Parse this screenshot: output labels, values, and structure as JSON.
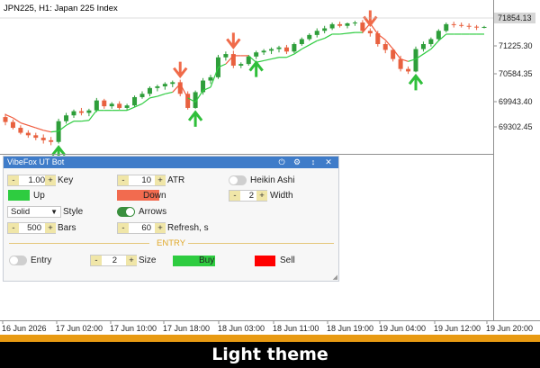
{
  "chart": {
    "title": "JPN225, H1:  Japan 225 Index",
    "current_price": "71854.13",
    "price_labels": [
      "71225.30",
      "70584.35",
      "69943.40",
      "69302.45"
    ],
    "time_labels": [
      "16 Jun 2026",
      "17 Jun 02:00",
      "17 Jun 10:00",
      "17 Jun 18:00",
      "18 Jun 03:00",
      "18 Jun 11:00",
      "18 Jun 19:00",
      "19 Jun 04:00",
      "19 Jun 12:00",
      "19 Jun 20:00"
    ],
    "colors": {
      "bull": "#2e9e3a",
      "bear": "#e8613f",
      "trail_up": "#2ecc40",
      "trail_down": "#f05a3c",
      "arrow_up": "#2fbf3a",
      "arrow_down": "#f06b4a",
      "price_tag": "#d6d6d6"
    }
  },
  "chart_data": {
    "type": "candlestick",
    "title": "JPN225, H1:  Japan 225 Index",
    "ylim": [
      68900,
      72200
    ],
    "candles_ohlc": [
      [
        69680,
        69760,
        69480,
        69560
      ],
      [
        69560,
        69620,
        69380,
        69420
      ],
      [
        69420,
        69480,
        69260,
        69300
      ],
      [
        69300,
        69360,
        69180,
        69240
      ],
      [
        69240,
        69300,
        69120,
        69180
      ],
      [
        69180,
        69260,
        69040,
        69120
      ],
      [
        69120,
        69200,
        69000,
        69080
      ],
      [
        69080,
        69640,
        69040,
        69580
      ],
      [
        69580,
        69780,
        69520,
        69720
      ],
      [
        69720,
        69860,
        69660,
        69820
      ],
      [
        69820,
        69900,
        69720,
        69780
      ],
      [
        69780,
        69880,
        69700,
        69840
      ],
      [
        69840,
        70140,
        69800,
        70080
      ],
      [
        70080,
        70120,
        69880,
        69940
      ],
      [
        69940,
        70040,
        69880,
        70000
      ],
      [
        70000,
        70060,
        69860,
        69900
      ],
      [
        69900,
        70000,
        69840,
        69960
      ],
      [
        69960,
        70200,
        69920,
        70160
      ],
      [
        70160,
        70300,
        70120,
        70240
      ],
      [
        70240,
        70420,
        70180,
        70380
      ],
      [
        70380,
        70460,
        70300,
        70420
      ],
      [
        70420,
        70520,
        70340,
        70480
      ],
      [
        70480,
        70560,
        70400,
        70520
      ],
      [
        70520,
        70580,
        70180,
        70240
      ],
      [
        70240,
        70300,
        69860,
        69900
      ],
      [
        69900,
        70320,
        69880,
        70280
      ],
      [
        70280,
        70620,
        70220,
        70560
      ],
      [
        70560,
        70700,
        70480,
        70640
      ],
      [
        70640,
        71180,
        70600,
        71120
      ],
      [
        71120,
        71260,
        71040,
        71200
      ],
      [
        71200,
        71280,
        70860,
        70920
      ],
      [
        70920,
        71000,
        70860,
        70960
      ],
      [
        70960,
        71180,
        70920,
        71140
      ],
      [
        71140,
        71280,
        71080,
        71240
      ],
      [
        71240,
        71320,
        71180,
        71280
      ],
      [
        71280,
        71360,
        71200,
        71320
      ],
      [
        71320,
        71400,
        71240,
        71360
      ],
      [
        71360,
        71420,
        71200,
        71260
      ],
      [
        71260,
        71480,
        71220,
        71440
      ],
      [
        71440,
        71600,
        71400,
        71560
      ],
      [
        71560,
        71700,
        71520,
        71660
      ],
      [
        71660,
        71820,
        71600,
        71760
      ],
      [
        71760,
        71880,
        71700,
        71820
      ],
      [
        71820,
        71960,
        71780,
        71920
      ],
      [
        71920,
        71980,
        71840,
        71880
      ],
      [
        71880,
        71960,
        71820,
        71940
      ],
      [
        71940,
        72000,
        71880,
        71960
      ],
      [
        71960,
        72020,
        71700,
        71760
      ],
      [
        71760,
        71820,
        71620,
        71700
      ],
      [
        71700,
        71760,
        71380,
        71440
      ],
      [
        71440,
        71500,
        71220,
        71300
      ],
      [
        71300,
        71340,
        71020,
        71080
      ],
      [
        71080,
        71160,
        70780,
        70840
      ],
      [
        70840,
        70900,
        70720,
        70780
      ],
      [
        70780,
        71380,
        70760,
        71320
      ],
      [
        71320,
        71500,
        71260,
        71440
      ],
      [
        71440,
        71600,
        71380,
        71560
      ],
      [
        71560,
        71800,
        71520,
        71760
      ],
      [
        71760,
        71960,
        71720,
        71920
      ],
      [
        71920,
        71980,
        71840,
        71900
      ],
      [
        71900,
        71960,
        71840,
        71880
      ],
      [
        71880,
        71940,
        71800,
        71860
      ],
      [
        71860,
        71900,
        71780,
        71840
      ],
      [
        71840,
        71880,
        71820,
        71854
      ]
    ],
    "xlabel": "",
    "ylabel": ""
  },
  "panel": {
    "title": "VibeFox UT Bot",
    "key": {
      "value": "1.00",
      "label": "Key"
    },
    "atr": {
      "value": "10",
      "label": "ATR"
    },
    "heikin": {
      "label": "Heikin Ashi",
      "enabled": false
    },
    "up": {
      "label": "Up",
      "color": "#2ecc40"
    },
    "down": {
      "label": "Down",
      "color": "#f26b4f"
    },
    "width": {
      "value": "2",
      "label": "Width"
    },
    "style": {
      "value": "Solid",
      "label": "Style"
    },
    "arrows": {
      "label": "Arrows",
      "enabled": true
    },
    "bars": {
      "value": "500",
      "label": "Bars"
    },
    "refresh": {
      "value": "60",
      "label": "Refresh, s"
    },
    "entry_header": "ENTRY",
    "entry": {
      "label": "Entry",
      "enabled": false
    },
    "size": {
      "value": "2",
      "label": "Size"
    },
    "buy": {
      "label": "Buy",
      "color": "#2ecc40"
    },
    "sell": {
      "label": "Sell",
      "color": "#ff0000"
    },
    "minus": "-",
    "plus": "+",
    "accent": "#3f7cc9",
    "icons": [
      "power-icon",
      "gear-icon",
      "collapse-icon",
      "close-icon"
    ]
  },
  "footer": {
    "text": "Light theme"
  }
}
